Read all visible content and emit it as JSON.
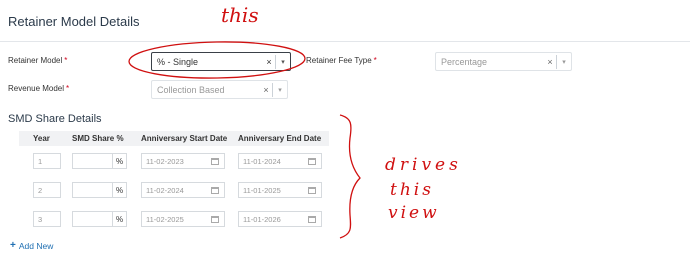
{
  "section": {
    "title": "Retainer Model Details"
  },
  "fields": {
    "retainer_model": {
      "label": "Retainer Model",
      "required": "*",
      "value": "% - Single",
      "clear": "×",
      "arrow": "▾"
    },
    "retainer_fee_type": {
      "label": "Retainer Fee Type",
      "required": "*",
      "value": "Percentage",
      "clear": "×",
      "arrow": "▾"
    },
    "revenue_model": {
      "label": "Revenue Model",
      "required": "*",
      "value": "Collection Based",
      "clear": "×",
      "arrow": "▾"
    }
  },
  "smd": {
    "title": "SMD Share Details",
    "columns": [
      "Year",
      "SMD Share %",
      "Anniversary Start Date",
      "Anniversary End Date"
    ],
    "rows": [
      {
        "year": "1",
        "share": "",
        "share_unit": "%",
        "start": "11-02-2023",
        "end": "11-01-2024"
      },
      {
        "year": "2",
        "share": "",
        "share_unit": "%",
        "start": "11-02-2024",
        "end": "11-01-2025"
      },
      {
        "year": "3",
        "share": "",
        "share_unit": "%",
        "start": "11-02-2025",
        "end": "11-01-2026"
      }
    ],
    "add_new": "Add New",
    "add_icon": "+"
  },
  "annotations": {
    "this_top": "this",
    "drives": "drives",
    "this_side": "this",
    "view": "view"
  },
  "colors": {
    "annotation": "#d01010",
    "link": "#1f6fb2",
    "required": "#d0021b"
  },
  "icons": [
    "clear-icon",
    "chevron-down-icon",
    "calendar-icon",
    "plus-icon"
  ]
}
